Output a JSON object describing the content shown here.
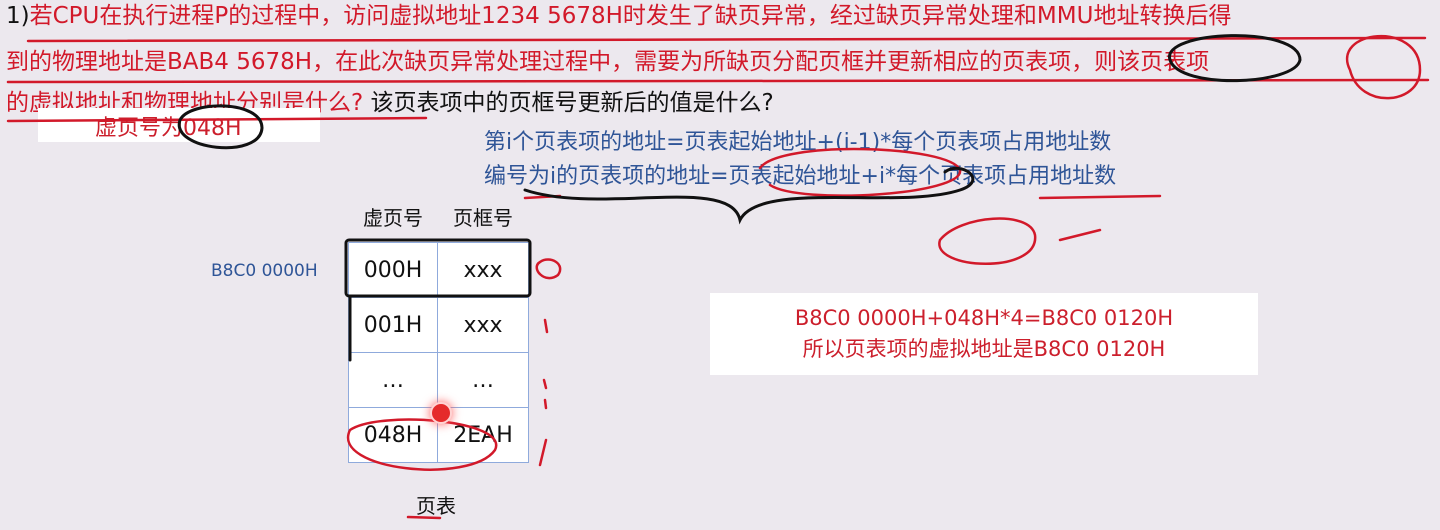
{
  "question": {
    "line1_prefix": "1)",
    "line1_red": "若CPU在执行进程P的过程中，访问虚拟地址1234 5678H时发生了缺页异常，经过缺页异常处理和MMU地址转换后得",
    "line2_red": "到的物理地址是BAB4  5678H，在此次缺页异常处理过程中，需要为所缺页分配页框并更新相应的页表项，则该页表项",
    "line3_red": "的虚拟地址和物理地址分别是什么?",
    "line3_black": " 该页表项中的页框号更新后的值是什么?"
  },
  "note_vpn": "虚页号为048H",
  "formulas": {
    "f1": "第i个页表项的地址=页表起始地址+(i-1)*每个页表项占用地址数",
    "f2": "编号为i的页表项的地址=页表起始地址+i*每个页表项占用地址数"
  },
  "page_table": {
    "base_address": "B8C0 0000H",
    "col_vpn": "虚页号",
    "col_pfn": "页框号",
    "rows": [
      {
        "vpn": "000H",
        "pfn": "xxx"
      },
      {
        "vpn": "001H",
        "pfn": "xxx"
      },
      {
        "vpn": "…",
        "pfn": "…"
      },
      {
        "vpn": "048H",
        "pfn": "2EAH"
      }
    ],
    "caption": "页表"
  },
  "answer": {
    "line1": "B8C0 0000H+048H*4=B8C0 0120H",
    "line2": "所以页表项的虚拟地址是B8C0 0120H"
  },
  "ink_color": "#d2192a"
}
